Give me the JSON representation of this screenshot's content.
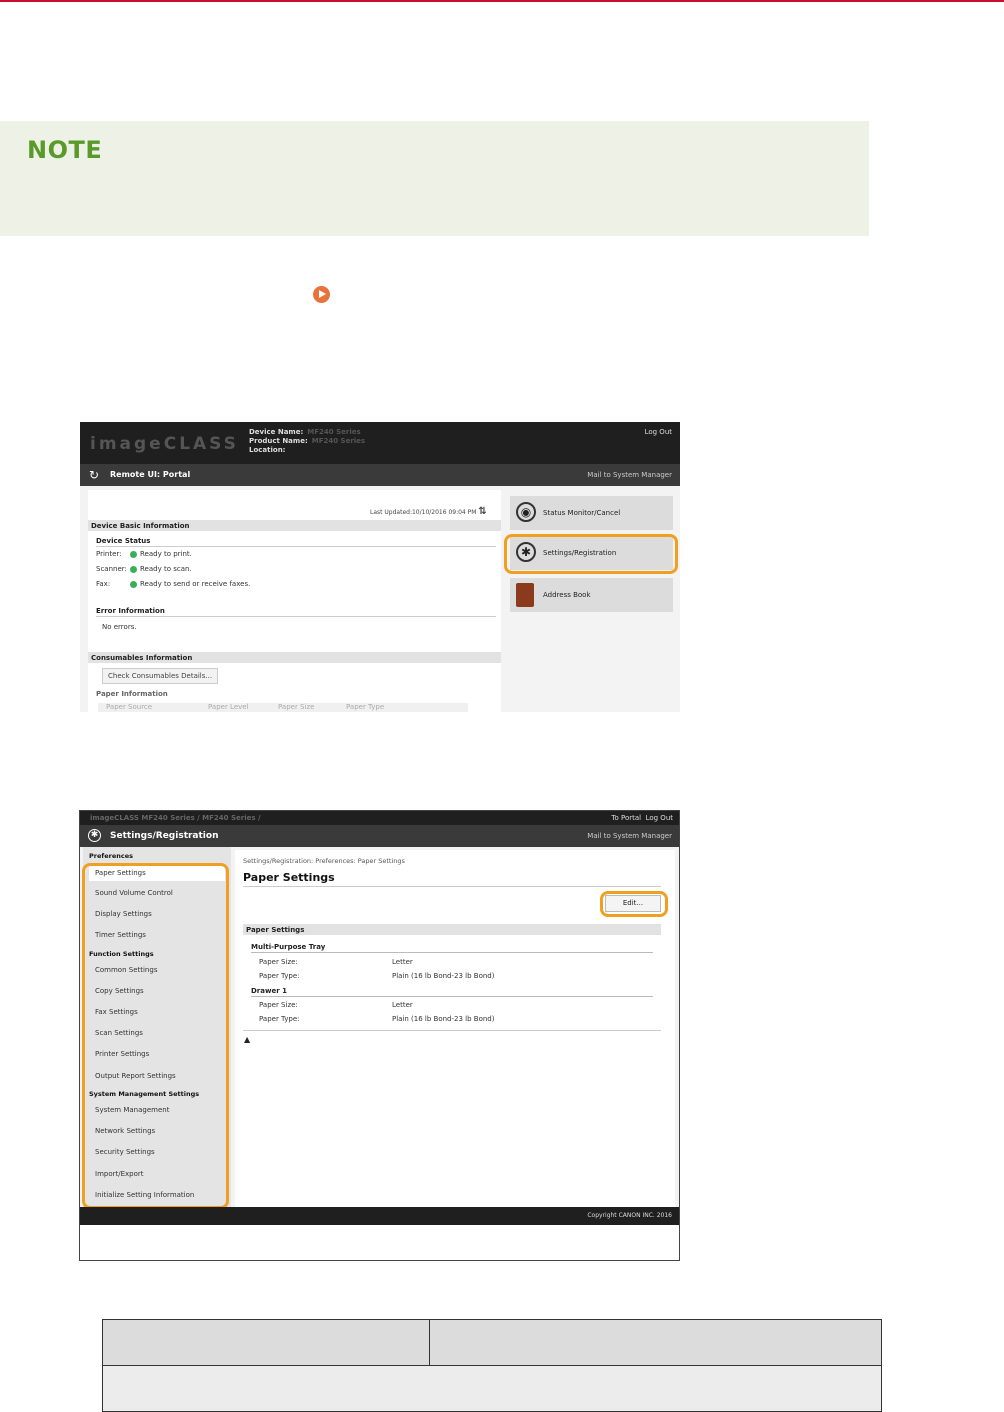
{
  "note": {
    "title": "NOTE"
  },
  "shot1": {
    "logo": "imageCLASS",
    "device_name_label": "Device Name:",
    "device_name_value": "MF240 Series",
    "product_name_label": "Product Name:",
    "product_name_value": "MF240 Series",
    "location_label": "Location:",
    "logout": "Log Out",
    "portal_title": "Remote UI: Portal",
    "mail": "Mail to System Manager",
    "last_updated": "Last Updated:10/10/2016 09:04 PM",
    "basic_info": "Device Basic Information",
    "device_status": "Device Status",
    "status_rows": [
      {
        "label": "Printer:",
        "text": "Ready to print."
      },
      {
        "label": "Scanner:",
        "text": "Ready to scan."
      },
      {
        "label": "Fax:",
        "text": "Ready to send or receive faxes."
      }
    ],
    "error_info": "Error Information",
    "no_errors": "No errors.",
    "consumables_info": "Consumables Information",
    "check_consumables": "Check Consumables Details...",
    "paper_info": "Paper Information",
    "paper_cols": [
      "Paper Source",
      "Paper Level",
      "Paper Size",
      "Paper Type"
    ],
    "side_buttons": [
      {
        "label": "Status Monitor/Cancel",
        "icon": "eye-icon"
      },
      {
        "label": "Settings/Registration",
        "icon": "settings-icon"
      },
      {
        "label": "Address Book",
        "icon": "book-icon"
      }
    ],
    "highlight_color": "#f0a020"
  },
  "shot2": {
    "crumb": "imageCLASS  MF240 Series / MF240 Series /",
    "to_portal": "To Portal",
    "logout": "Log Out",
    "title": "Settings/Registration",
    "mail": "Mail to System Manager",
    "nav": {
      "preferences": "Preferences",
      "pref_items": [
        "Paper Settings",
        "Sound Volume Control",
        "Display Settings",
        "Timer Settings"
      ],
      "function": "Function Settings",
      "func_items": [
        "Common Settings",
        "Copy Settings",
        "Fax Settings",
        "Scan Settings",
        "Printer Settings",
        "Output Report Settings"
      ],
      "system": "System Management Settings",
      "sys_items": [
        "System Management",
        "Network Settings",
        "Security Settings",
        "Import/Export",
        "Initialize Setting Information"
      ]
    },
    "breadcrumb": "Settings/Registration: Preferences: Paper Settings",
    "page_title": "Paper Settings",
    "edit": "Edit...",
    "section": "Paper Settings",
    "tray": "Multi-Purpose Tray",
    "drawer": "Drawer 1",
    "size_label": "Paper Size:",
    "type_label": "Paper Type:",
    "tray_size": "Letter",
    "tray_type": "Plain (16 lb Bond-23 lb Bond)",
    "drawer_size": "Letter",
    "drawer_type": "Plain (16 lb Bond-23 lb Bond)",
    "top_glyph": "▲",
    "copyright": "Copyright CANON INC. 2016"
  }
}
